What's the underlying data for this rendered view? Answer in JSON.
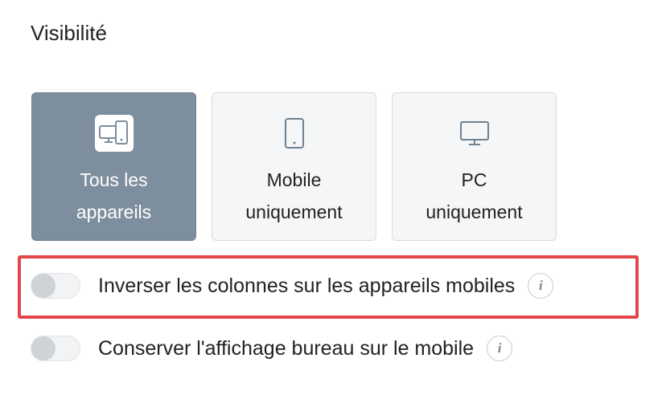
{
  "section": {
    "title": "Visibilité"
  },
  "visibility_options": [
    {
      "label": "Tous les\nappareils",
      "icon": "all-devices-icon",
      "selected": true
    },
    {
      "label": "Mobile\nuniquement",
      "icon": "mobile-icon",
      "selected": false
    },
    {
      "label": "PC\nuniquement",
      "icon": "desktop-icon",
      "selected": false
    }
  ],
  "settings": [
    {
      "label": "Inverser les colonnes sur les appareils mobiles",
      "enabled": false,
      "info_icon": "info-icon"
    },
    {
      "label": "Conserver l'affichage bureau sur le mobile",
      "enabled": false,
      "info_icon": "info-icon"
    }
  ],
  "info_glyph": "i",
  "colors": {
    "selected_card": "#7d8e9e",
    "highlight": "#e3474c"
  }
}
